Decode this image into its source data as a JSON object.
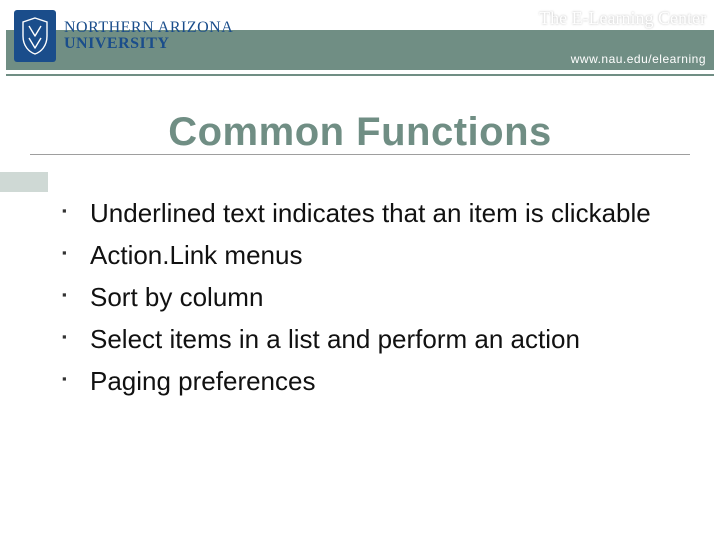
{
  "header": {
    "university_line1": "NORTHERN ARIZONA",
    "university_line2": "UNIVERSITY",
    "elc_label": "The E-Learning Center",
    "elc_url": "www.nau.edu/elearning"
  },
  "title": "Common Functions",
  "bullets": [
    "Underlined text indicates that an item is clickable",
    "Action.Link menus",
    "Sort by column",
    "Select items in a list and perform an action",
    "Paging preferences"
  ]
}
